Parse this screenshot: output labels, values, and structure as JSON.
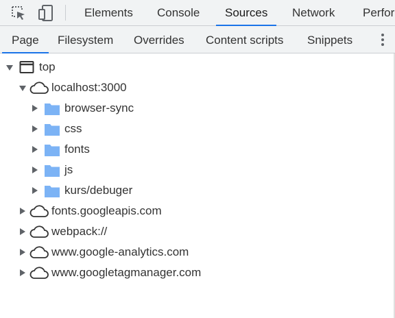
{
  "toolbar": {
    "tabs": [
      {
        "label": "Elements"
      },
      {
        "label": "Console"
      },
      {
        "label": "Sources"
      },
      {
        "label": "Network"
      },
      {
        "label": "Perfor"
      }
    ]
  },
  "navigator": {
    "tabs": [
      {
        "label": "Page"
      },
      {
        "label": "Filesystem"
      },
      {
        "label": "Overrides"
      },
      {
        "label": "Content scripts"
      },
      {
        "label": "Snippets"
      }
    ]
  },
  "tree": [
    {
      "label": "top"
    },
    {
      "label": "localhost:3000"
    },
    {
      "label": "browser-sync"
    },
    {
      "label": "css"
    },
    {
      "label": "fonts"
    },
    {
      "label": "js"
    },
    {
      "label": "kurs/debuger"
    },
    {
      "label": "fonts.googleapis.com"
    },
    {
      "label": "webpack://"
    },
    {
      "label": "www.google-analytics.com"
    },
    {
      "label": "www.googletagmanager.com"
    }
  ],
  "colors": {
    "accent": "#1a73e8",
    "folder": "#7cb3f5"
  }
}
